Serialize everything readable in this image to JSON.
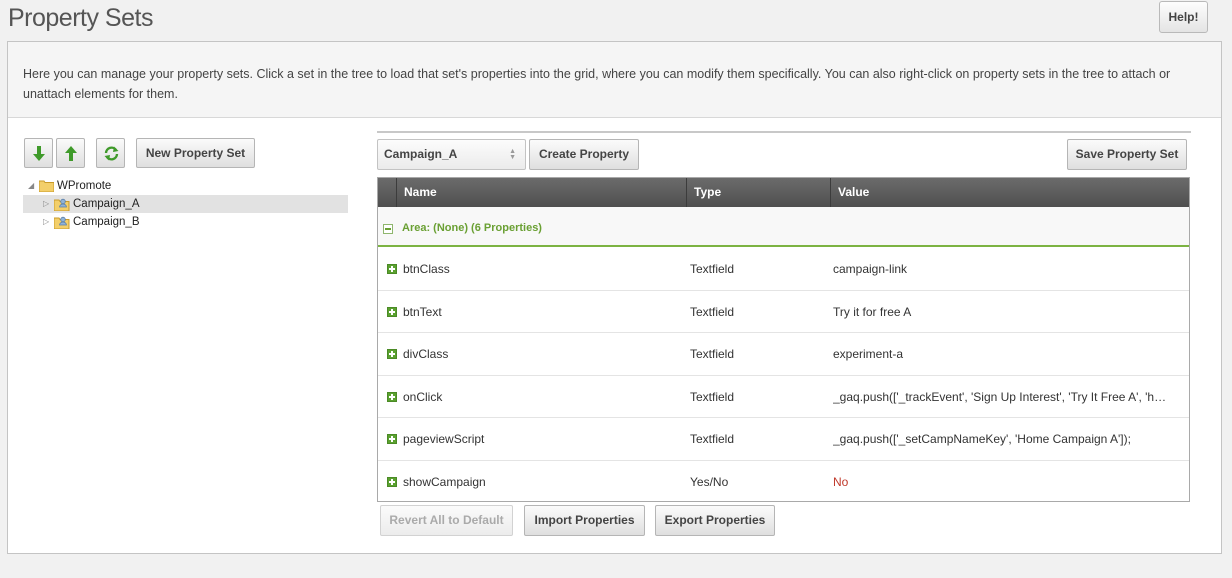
{
  "page": {
    "title": "Property Sets",
    "help_label": "Help!"
  },
  "intro": {
    "text": "Here you can manage your property sets. Click a set in the tree to load that set's properties into the grid, where you can modify them specifically. You can also right-click on property sets in the tree to attach or unattach elements for them."
  },
  "tree_toolbar": {
    "expand_icon": "arrow-down-icon",
    "collapse_icon": "arrow-up-icon",
    "refresh_icon": "refresh-icon",
    "new_set_label": "New Property Set"
  },
  "tree": {
    "root": {
      "label": "WPromote",
      "icon": "folder-icon"
    },
    "children": [
      {
        "label": "Campaign_A",
        "icon": "folder-user-icon",
        "selected": true
      },
      {
        "label": "Campaign_B",
        "icon": "folder-user-icon",
        "selected": false
      }
    ]
  },
  "grid_toolbar": {
    "selected_set": "Campaign_A",
    "create_label": "Create Property",
    "save_label": "Save Property Set"
  },
  "grid": {
    "columns": [
      "Name",
      "Type",
      "Value"
    ],
    "group_label": "Area: (None) (6 Properties)",
    "rows": [
      {
        "name": "btnClass",
        "type": "Textfield",
        "value": "campaign-link"
      },
      {
        "name": "btnText",
        "type": "Textfield",
        "value": "Try it for free A"
      },
      {
        "name": "divClass",
        "type": "Textfield",
        "value": "experiment-a"
      },
      {
        "name": "onClick",
        "type": "Textfield",
        "value": "_gaq.push(['_trackEvent', 'Sign Up Interest', 'Try It Free A', 'h…"
      },
      {
        "name": "pageviewScript",
        "type": "Textfield",
        "value": "_gaq.push(['_setCampNameKey', 'Home Campaign A']);"
      },
      {
        "name": "showCampaign",
        "type": "Yes/No",
        "value": "No"
      }
    ]
  },
  "grid_footer": {
    "revert_label": "Revert All to Default",
    "import_label": "Import Properties",
    "export_label": "Export Properties"
  },
  "colors": {
    "group_green": "#6aa033",
    "value_no_red": "#c0392b",
    "header_dark": "#555555"
  }
}
